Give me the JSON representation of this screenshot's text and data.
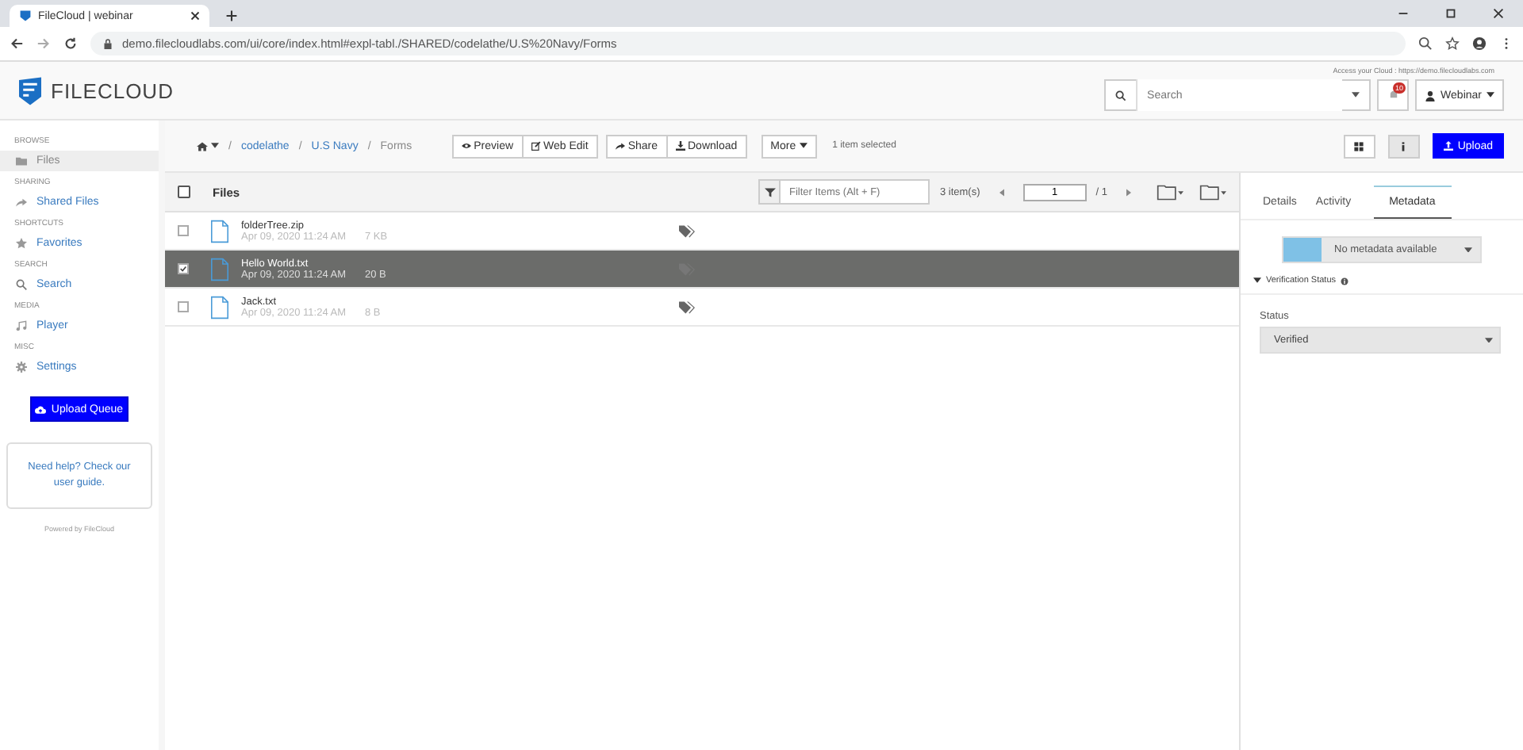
{
  "browser": {
    "tab_title": "FileCloud | webinar",
    "url": "demo.filecloudlabs.com/ui/core/index.html#expl-tabl./SHARED/codelathe/U.S%20Navy/Forms"
  },
  "header": {
    "logo": "FILECLOUD",
    "access_text": "Access your Cloud : https://demo.filecloudlabs.com",
    "search_placeholder": "Search",
    "notifications": "10",
    "user": "Webinar"
  },
  "sidebar": {
    "sections": [
      {
        "heading": "BROWSE",
        "items": [
          {
            "label": "Files",
            "kind": "folder",
            "selected": true
          }
        ]
      },
      {
        "heading": "SHARING",
        "items": [
          {
            "label": "Shared Files",
            "kind": "share",
            "selected": false
          }
        ]
      },
      {
        "heading": "SHORTCUTS",
        "items": [
          {
            "label": "Favorites",
            "kind": "star",
            "selected": false
          }
        ]
      },
      {
        "heading": "SEARCH",
        "items": [
          {
            "label": "Search",
            "kind": "search",
            "selected": false
          }
        ]
      },
      {
        "heading": "MEDIA",
        "items": [
          {
            "label": "Player",
            "kind": "music",
            "selected": false
          }
        ]
      },
      {
        "heading": "MISC",
        "items": [
          {
            "label": "Settings",
            "kind": "gear",
            "selected": false
          }
        ]
      }
    ],
    "upload_queue": "Upload Queue",
    "help": "Need help? Check our user guide.",
    "powered": "Powered by FileCloud"
  },
  "toolbar": {
    "breadcrumb": [
      "codelathe",
      "U.S Navy",
      "Forms"
    ],
    "separator": "/",
    "button_groups": [
      [
        {
          "label": "Preview",
          "kind": "eye"
        },
        {
          "label": "Web Edit",
          "kind": "edit"
        }
      ],
      [
        {
          "label": "Share",
          "kind": "share"
        },
        {
          "label": "Download",
          "kind": "download"
        }
      ]
    ],
    "more": "More",
    "status": "1 item selected",
    "upload": "Upload"
  },
  "files": {
    "all_checked": false,
    "heading": "Files",
    "filter_placeholder": "Filter Items (Alt + F)",
    "count": "3 item(s)",
    "page": "1",
    "total": "/ 1",
    "rows": [
      {
        "name": "folderTree.zip",
        "date": "Apr 09, 2020 11:24 AM",
        "size": "7 KB",
        "selected": false
      },
      {
        "name": "Hello World.txt",
        "date": "Apr 09, 2020 11:24 AM",
        "size": "20 B",
        "selected": true
      },
      {
        "name": "Jack.txt",
        "date": "Apr 09, 2020 11:24 AM",
        "size": "8 B",
        "selected": false
      }
    ]
  },
  "panel": {
    "tabs": [
      {
        "label": "Details",
        "selected": false
      },
      {
        "label": "Activity",
        "selected": false
      },
      {
        "label": "Metadata",
        "selected": true
      }
    ],
    "metadata_select": "No metadata available",
    "section": "Verification Status",
    "field_label": "Status",
    "field_value": "Verified"
  }
}
